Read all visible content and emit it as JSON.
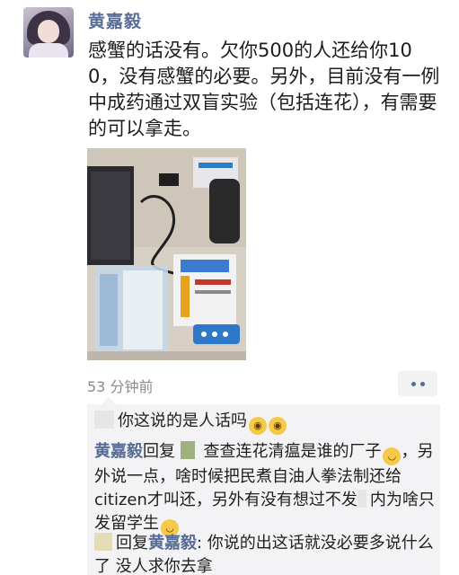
{
  "post": {
    "username": "黄嘉毅",
    "text": "感蟹的话没有。欠你500的人还给你100，没有感蟹的必要。另外，目前没有一例中成药通过双盲实验（包括连花），有需要的可以拿走。",
    "timestamp": "53 分钟前",
    "avatar_icon": "avatar-anime-girl",
    "photo_alt": "photo-of-medicine-boxes-on-desk"
  },
  "comments": [
    {
      "text": "你这说的是人话吗",
      "emoji": [
        "flushed-face",
        "flushed-face"
      ]
    },
    {
      "author": "黄嘉毅",
      "reply_word": "回复",
      "text": "查查连花清瘟是谁的厂子",
      "text2": "，另外说一点，啥时候把民煮自油人拳法制还给citizen才叫还，另外有没有想过不发",
      "text3": "内为啥只发留学生",
      "emoji": [
        "smiling-face",
        "smiling-face"
      ]
    },
    {
      "reply_word": "回复",
      "target": "黄嘉毅",
      "text": ": 你说的出这话就没必要多说什么了 没人求你去拿"
    }
  ],
  "colors": {
    "nickname": "#576b95",
    "comment_bg": "#f3f3f5",
    "timestamp": "#8b8b8b"
  }
}
